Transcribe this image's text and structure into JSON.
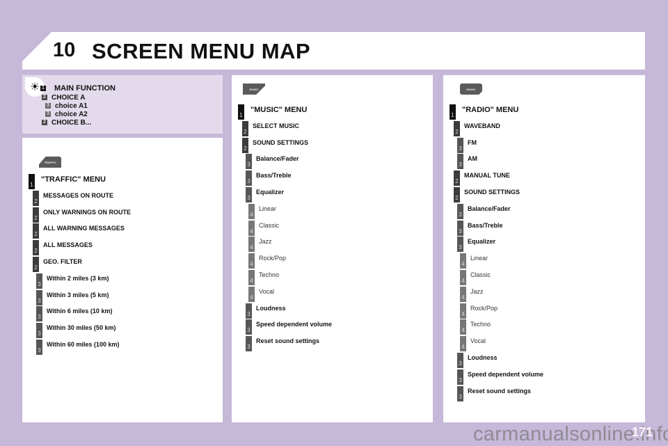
{
  "header": {
    "chapter_number": "10",
    "title": "SCREEN MENU MAP"
  },
  "legend": {
    "icon": "brightness-icon",
    "rows": [
      {
        "level": "1",
        "label": "MAIN FUNCTION"
      },
      {
        "level": "2",
        "label": "CHOICE A"
      },
      {
        "level": "3",
        "label": "choice A1"
      },
      {
        "level": "3",
        "label": "choice A2"
      },
      {
        "level": "2",
        "label": "CHOICE B..."
      }
    ]
  },
  "traffic": {
    "tab_icon_label": "TRAFFIC",
    "items": [
      {
        "level": "1",
        "label": "\"TRAFFIC\" MENU"
      },
      {
        "level": "2",
        "label": "MESSAGES ON ROUTE"
      },
      {
        "level": "2",
        "label": "ONLY WARNINGS ON ROUTE"
      },
      {
        "level": "2",
        "label": "ALL WARNING MESSAGES"
      },
      {
        "level": "2",
        "label": "ALL MESSAGES"
      },
      {
        "level": "2",
        "label": "GEO. FILTER"
      },
      {
        "level": "3",
        "label": "Within 2 miles (3 km)"
      },
      {
        "level": "3",
        "label": "Within 3 miles (5 km)"
      },
      {
        "level": "3",
        "label": "Within 6 miles (10 km)"
      },
      {
        "level": "3",
        "label": "Within 30 miles (50 km)"
      },
      {
        "level": "3",
        "label": "Within 60 miles (100 km)"
      }
    ]
  },
  "music": {
    "tab_icon_label": "MUSIC",
    "items": [
      {
        "level": "1",
        "label": "\"MUSIC\" MENU"
      },
      {
        "level": "2",
        "label": "SELECT MUSIC"
      },
      {
        "level": "2",
        "label": "SOUND SETTINGS"
      },
      {
        "level": "3",
        "label": "Balance/Fader"
      },
      {
        "level": "3",
        "label": "Bass/Treble"
      },
      {
        "level": "3",
        "label": "Equalizer"
      },
      {
        "level": "4",
        "label": "Linear"
      },
      {
        "level": "4",
        "label": "Classic"
      },
      {
        "level": "4",
        "label": "Jazz"
      },
      {
        "level": "4",
        "label": "Rock/Pop"
      },
      {
        "level": "4",
        "label": "Techno"
      },
      {
        "level": "4",
        "label": "Vocal"
      },
      {
        "level": "3",
        "label": "Loudness"
      },
      {
        "level": "3",
        "label": "Speed dependent volume"
      },
      {
        "level": "3",
        "label": "Reset sound settings"
      }
    ]
  },
  "radio": {
    "tab_icon_label": "RADIO",
    "items": [
      {
        "level": "1",
        "label": "\"RADIO\" MENU"
      },
      {
        "level": "2",
        "label": "WAVEBAND"
      },
      {
        "level": "3",
        "label": "FM"
      },
      {
        "level": "3",
        "label": "AM"
      },
      {
        "level": "2",
        "label": "MANUAL TUNE"
      },
      {
        "level": "2",
        "label": "SOUND SETTINGS"
      },
      {
        "level": "3",
        "label": "Balance/Fader"
      },
      {
        "level": "3",
        "label": "Bass/Treble"
      },
      {
        "level": "3",
        "label": "Equalizer"
      },
      {
        "level": "4",
        "label": "Linear"
      },
      {
        "level": "4",
        "label": "Classic"
      },
      {
        "level": "4",
        "label": "Jazz"
      },
      {
        "level": "4",
        "label": "Rock/Pop"
      },
      {
        "level": "4",
        "label": "Techno"
      },
      {
        "level": "4",
        "label": "Vocal"
      },
      {
        "level": "3",
        "label": "Loudness"
      },
      {
        "level": "3",
        "label": "Speed dependent volume"
      },
      {
        "level": "3",
        "label": "Reset sound settings"
      }
    ]
  },
  "footer": {
    "page_number": "171",
    "watermark": "carmanualsonline.info"
  }
}
